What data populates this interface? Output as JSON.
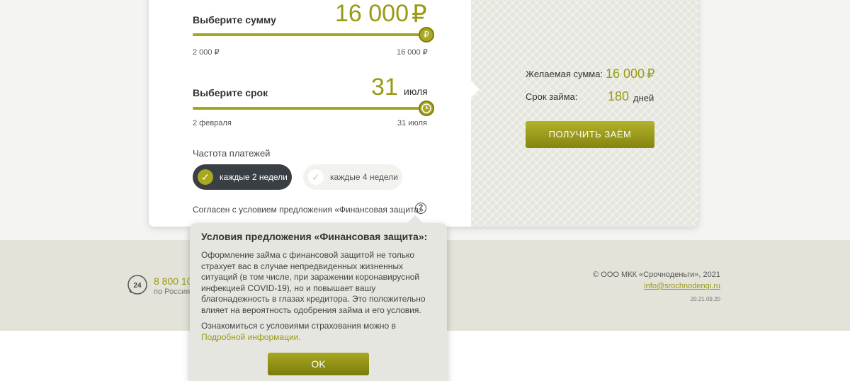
{
  "calculator": {
    "amount": {
      "label": "Выберите сумму",
      "value": "16 000",
      "currency": "₽",
      "min_label": "2 000 ₽",
      "max_label": "16 000 ₽",
      "thumb_symbol": "₽",
      "slider_fraction": 1.0
    },
    "term": {
      "label": "Выберите срок",
      "day": "31",
      "month": "июля",
      "min_label": "2 февраля",
      "max_label": "31 июля",
      "slider_fraction": 1.0
    },
    "frequency": {
      "label": "Частота платежей",
      "options": [
        {
          "label": "каждые 2 недели",
          "selected": true
        },
        {
          "label": "каждые 4 недели",
          "selected": false
        }
      ]
    },
    "agreement": {
      "text": "Согласен с условием предложения «Финансовая защита»",
      "help_symbol": "?"
    }
  },
  "summary": {
    "desired_label": "Желаемая сумма:",
    "desired_value": "16 000",
    "desired_currency": "₽",
    "term_label": "Срок займа:",
    "term_value": "180",
    "term_unit": "дней",
    "button_label": "ПОЛУЧИТЬ ЗАЁМ"
  },
  "popup": {
    "title": "Условия предложения «Финансовая защита»:",
    "body": "Оформление займа с финансовой защитой не только страхует вас в случае непредвиденных жизненных ситуаций (в том числе, при заражении коронавирусной инфекцией COVID-19), но и повышает вашу благонадежность в глазах кредитора. Это положительно влияет на вероятность одобрения займа и его условия.",
    "body2_prefix": "Ознакомиться с условиями страхования можно в ",
    "body2_link": "Подробной информации.",
    "ok_label": "OK"
  },
  "footer": {
    "phone_badge": "24",
    "phone": "8 800 100",
    "phone_sub": "по Россия",
    "copyright": "© ООО МКК «Срочноденьги», 2021",
    "email": "info@srochnodengi.ru",
    "version": "20.21.09.20"
  },
  "colors": {
    "accent": "#9a9a16",
    "dark_button": "#3a3f44",
    "footer_bg": "#e3e3d9"
  }
}
